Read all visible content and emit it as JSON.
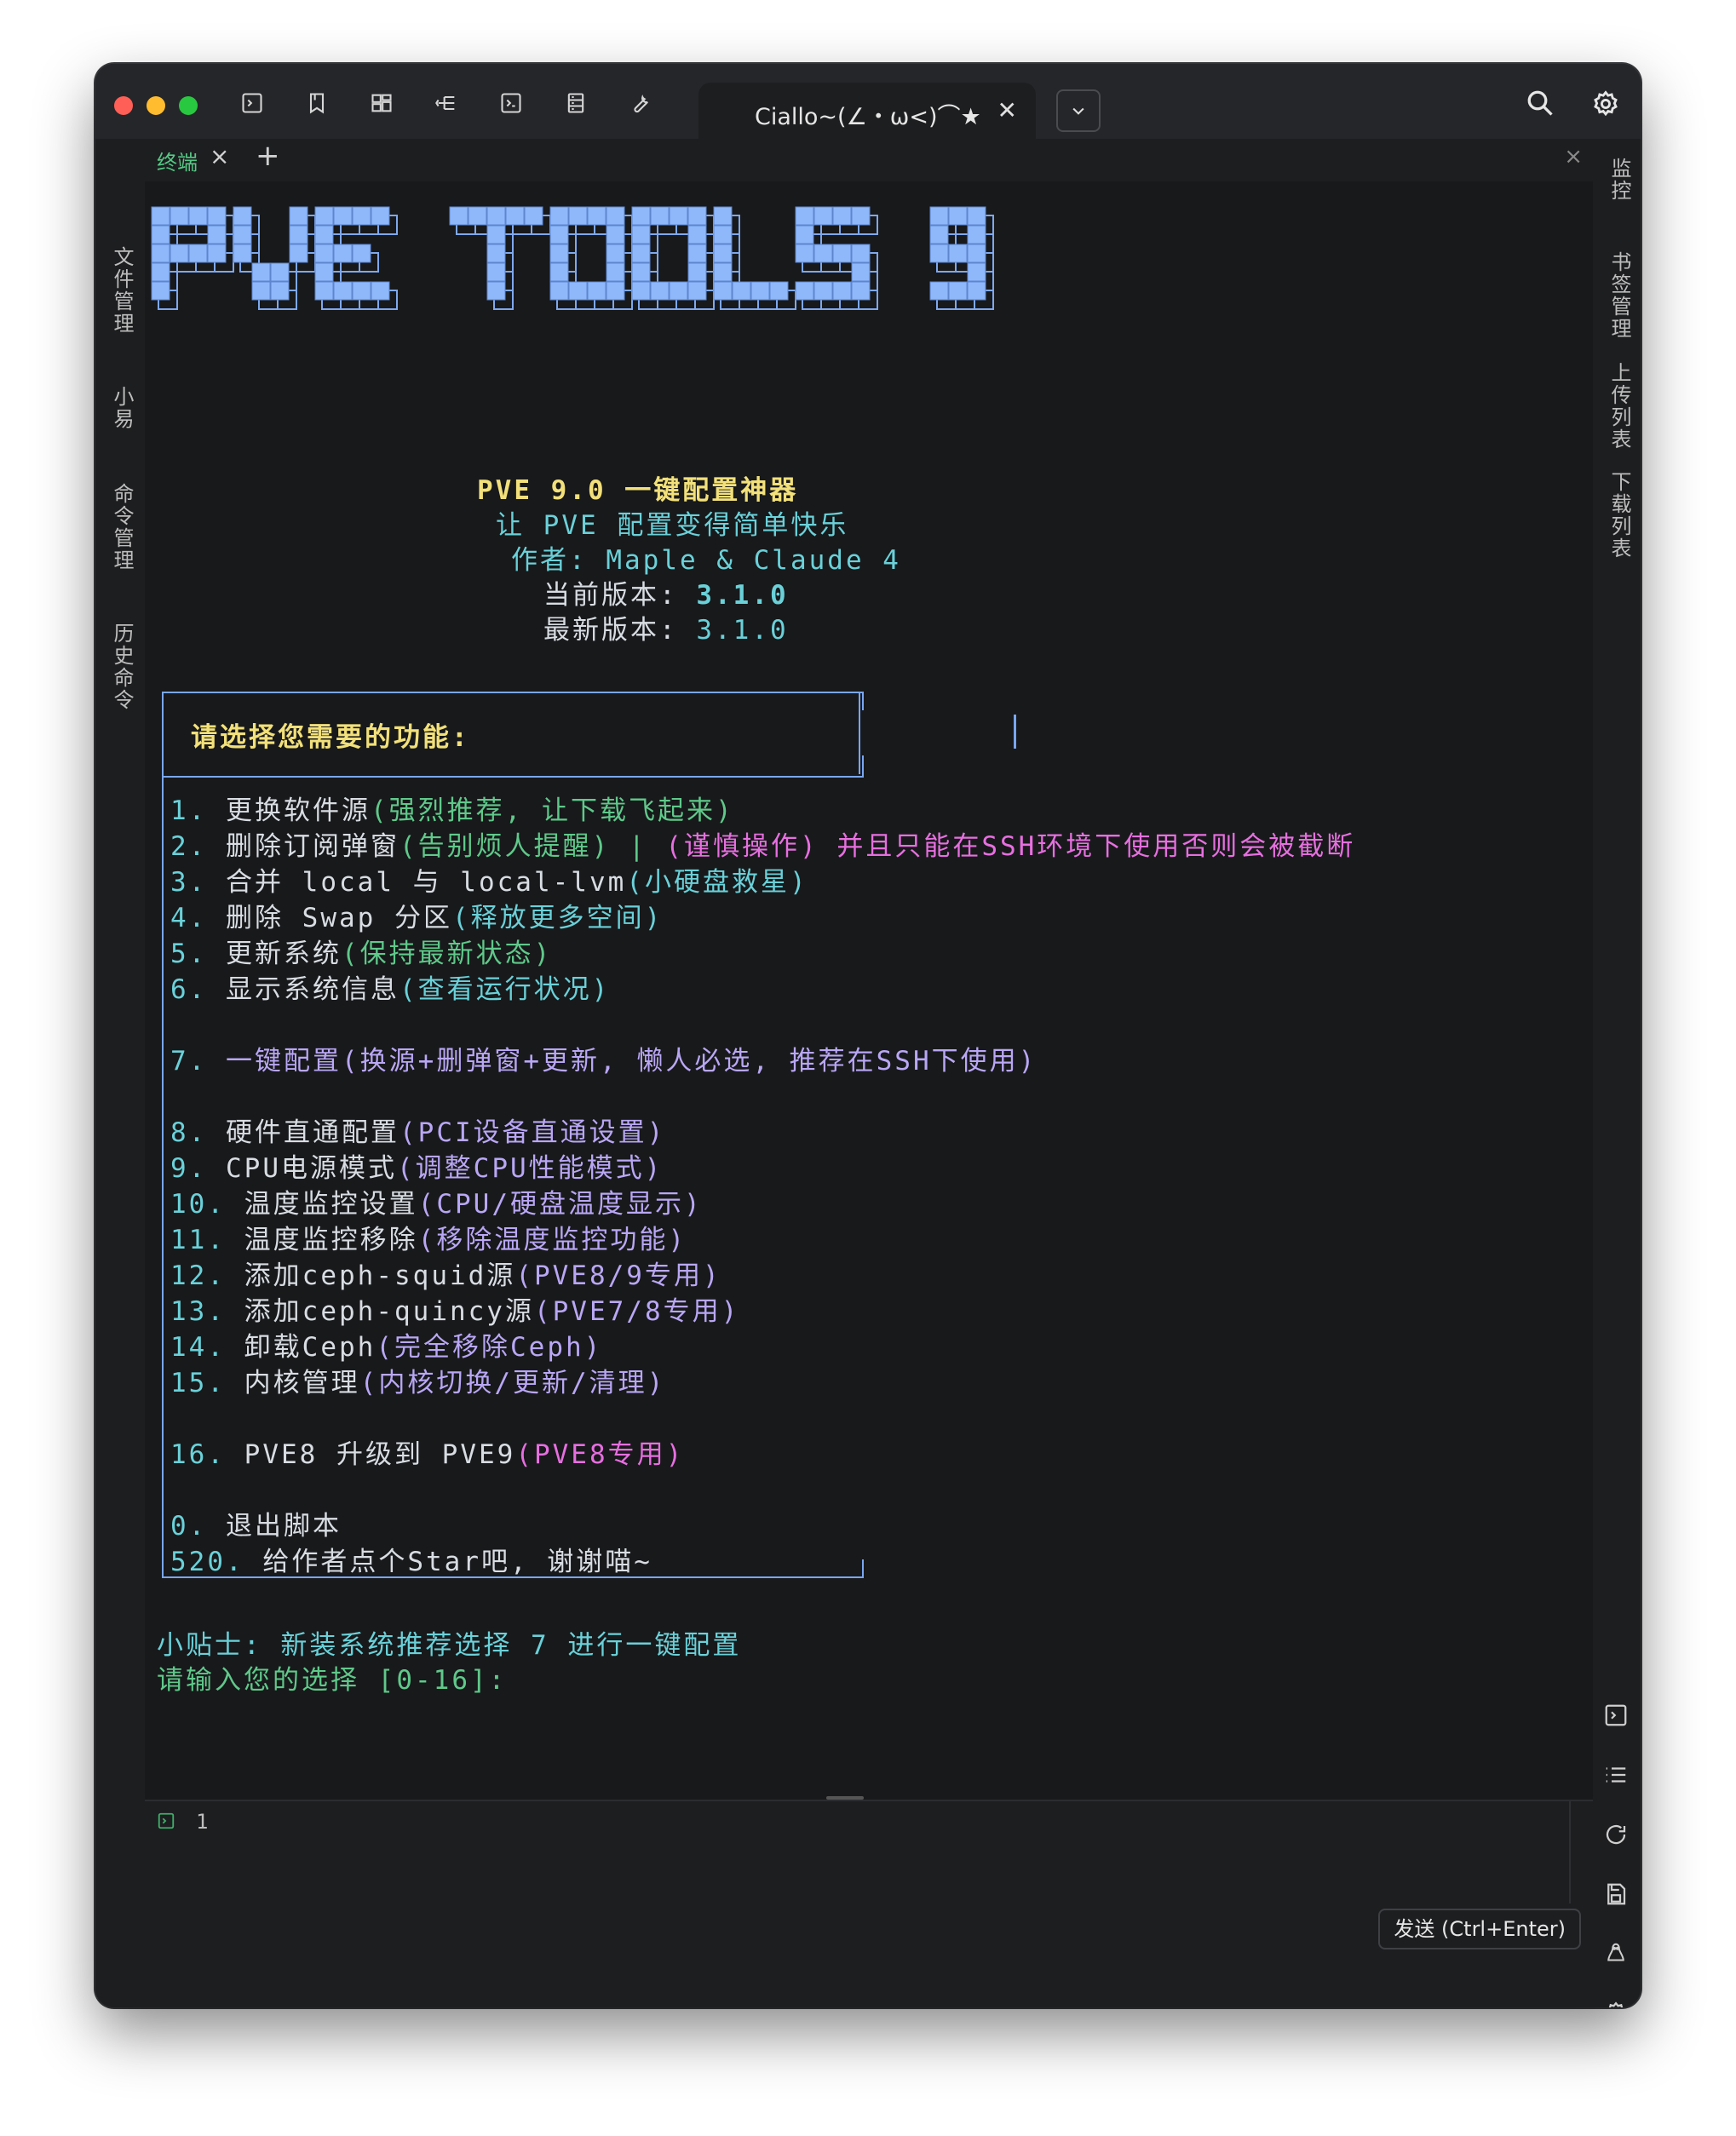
{
  "window": {
    "tab_title": "Ciallo~(∠・ω<)⌒★",
    "traffic_lights": [
      "#ff5f57",
      "#febc2e",
      "#28c840"
    ],
    "toolbar_icons": [
      "terminal-icon",
      "bookmark-icon",
      "sftp-icon",
      "tree-icon",
      "terminal-alt-icon",
      "server-icon",
      "wrench-icon"
    ]
  },
  "left_rail": [
    "文件管理",
    "小易",
    "命令管理",
    "历史命令"
  ],
  "right_rail": [
    "监控",
    "书签管理",
    "上传列表",
    "下载列表"
  ],
  "terminal_tabs": {
    "active": "终端",
    "add": "+",
    "close": "×"
  },
  "banner": {
    "title": "PVE 9.0 一键配置神器",
    "subtitle": "让 PVE 配置变得简单快乐",
    "author_label": "作者: ",
    "author": "Maple & Claude 4",
    "current_label": "当前版本: ",
    "current_version": "3.1.0",
    "latest_label": "最新版本: ",
    "latest_version": "3.1.0"
  },
  "menu": {
    "header": "请选择您需要的功能:",
    "items": [
      {
        "num": "1.",
        "name": "更换软件源",
        "note": "(强烈推荐, 让下载飞起来)",
        "extra": ""
      },
      {
        "num": "2.",
        "name": "删除订阅弹窗",
        "note": "(告别烦人提醒) | ",
        "extra": "(谨慎操作) 并且只能在SSH环境下使用否则会被截断"
      },
      {
        "num": "3.",
        "name": "合并 local 与 local-lvm",
        "note": "(小硬盘救星)",
        "extra": ""
      },
      {
        "num": "4.",
        "name": "删除 Swap 分区",
        "note": "(释放更多空间)",
        "extra": ""
      },
      {
        "num": "5.",
        "name": "更新系统",
        "note": "(保持最新状态)",
        "extra": ""
      },
      {
        "num": "6.",
        "name": "显示系统信息",
        "note": "(查看运行状况)",
        "extra": ""
      },
      {
        "num": "7.",
        "name": "一键配置",
        "note": "(换源+删弹窗+更新, 懒人必选, 推荐在SSH下使用)",
        "extra": ""
      },
      {
        "num": "8.",
        "name": "硬件直通配置",
        "note": "(PCI设备直通设置)",
        "extra": ""
      },
      {
        "num": "9.",
        "name": "CPU电源模式",
        "note": "(调整CPU性能模式)",
        "extra": ""
      },
      {
        "num": "10.",
        "name": "温度监控设置",
        "note": "(CPU/硬盘温度显示)",
        "extra": ""
      },
      {
        "num": "11.",
        "name": "温度监控移除",
        "note": "(移除温度监控功能)",
        "extra": ""
      },
      {
        "num": "12.",
        "name": "添加ceph-squid源",
        "note": "(PVE8/9专用)",
        "extra": ""
      },
      {
        "num": "13.",
        "name": "添加ceph-quincy源",
        "note": "(PVE7/8专用)",
        "extra": ""
      },
      {
        "num": "14.",
        "name": "卸载Ceph",
        "note": "(完全移除Ceph)",
        "extra": ""
      },
      {
        "num": "15.",
        "name": "内核管理",
        "note": "(内核切换/更新/清理)",
        "extra": ""
      },
      {
        "num": "16.",
        "name": "PVE8 升级到 PVE9",
        "note": "(PVE8专用)",
        "extra": ""
      },
      {
        "num": "0.",
        "name": "退出脚本",
        "note": "",
        "extra": ""
      },
      {
        "num": "520.",
        "name": "给作者点个Star吧, 谢谢喵~",
        "note": "",
        "extra": ""
      }
    ]
  },
  "tip": "小贴士: 新装系统推荐选择 7 进行一键配置",
  "prompt": "请输入您的选择 [0-16]:",
  "editor": {
    "line_number": "1",
    "send_label": "发送 (Ctrl+Enter)"
  },
  "colors": {
    "banner_blue": "#86b4ff",
    "green": "#5fc98a",
    "teal": "#6ad1d9",
    "yellow": "#f2e07a",
    "pink": "#e76fe0",
    "purple": "#b9a7f5",
    "box_blue": "#79a6f2"
  }
}
